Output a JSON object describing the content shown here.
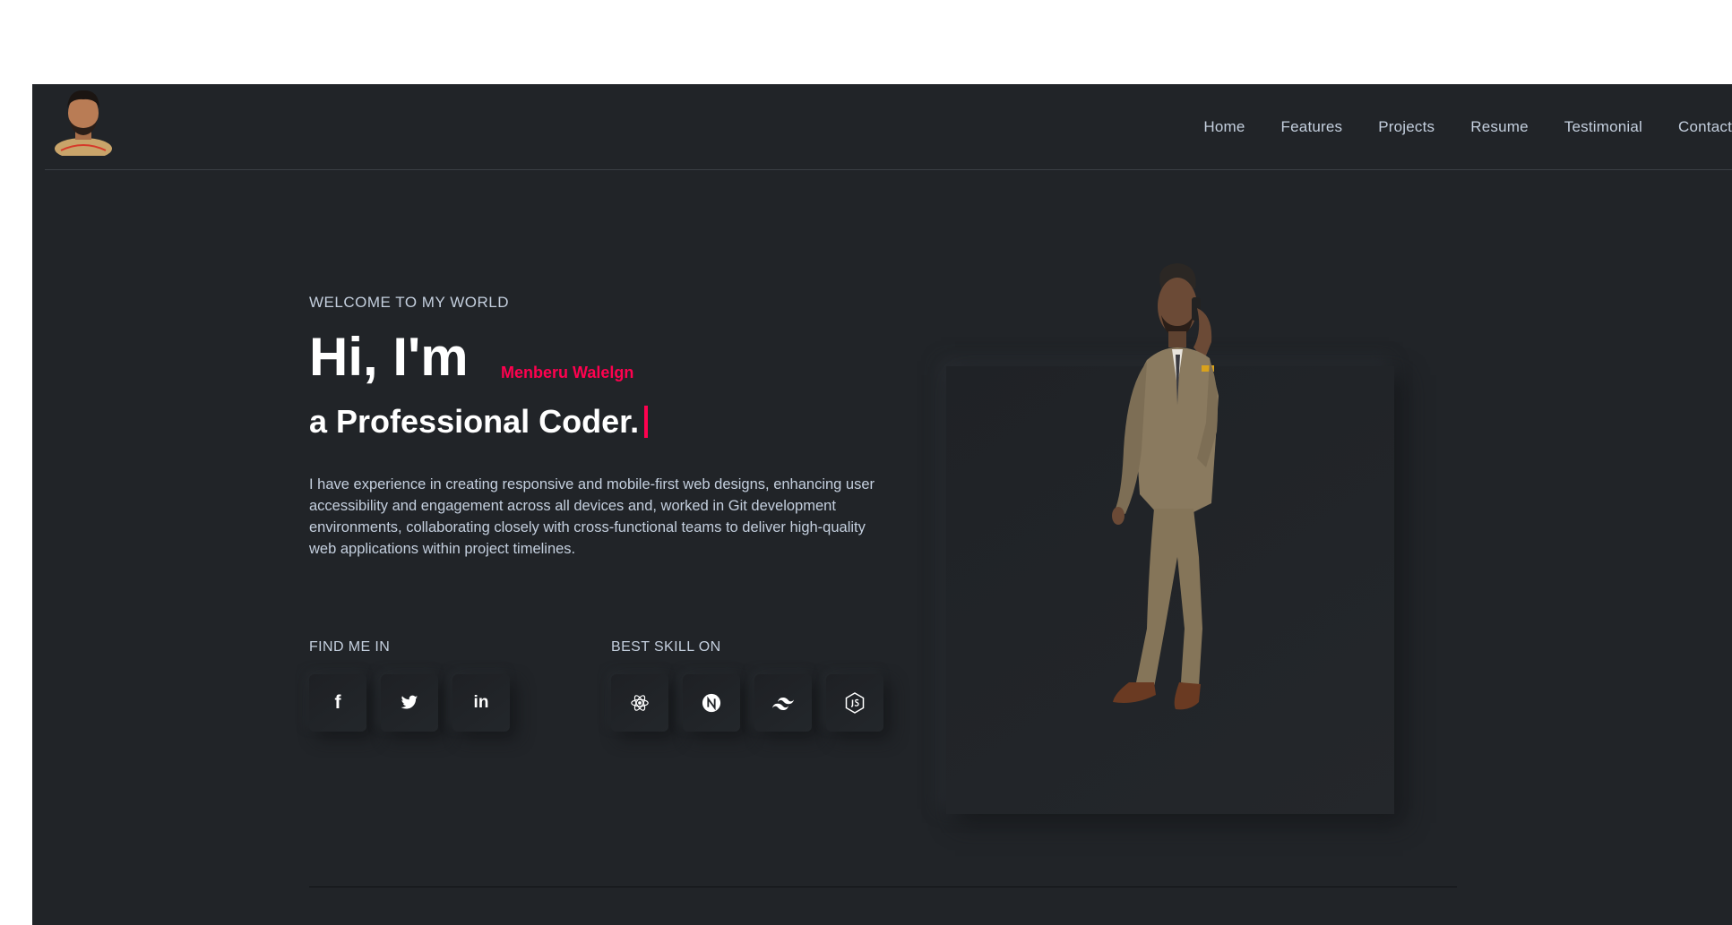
{
  "nav": {
    "items": [
      {
        "label": "Home"
      },
      {
        "label": "Features"
      },
      {
        "label": "Projects"
      },
      {
        "label": "Resume"
      },
      {
        "label": "Testimonial"
      },
      {
        "label": "Contact"
      }
    ]
  },
  "hero": {
    "welcome": "WELCOME TO MY WORLD",
    "greeting": "Hi, I'm",
    "name": "Menberu Walelgn",
    "tagline": "a Professional Coder.",
    "description": "I have experience in creating responsive and mobile-first web designs, enhancing user accessibility and engagement across all devices and, worked in Git development environments, collaborating closely with cross-functional teams to deliver high-quality web applications within project timelines."
  },
  "social": {
    "label": "FIND ME IN",
    "items": [
      {
        "icon": "facebook-icon"
      },
      {
        "icon": "twitter-icon"
      },
      {
        "icon": "linkedin-icon"
      }
    ]
  },
  "skills": {
    "label": "BEST SKILL ON",
    "items": [
      {
        "icon": "react-icon"
      },
      {
        "icon": "nextjs-icon"
      },
      {
        "icon": "tailwind-icon"
      },
      {
        "icon": "nodejs-icon"
      }
    ]
  },
  "colors": {
    "background": "#212428",
    "accent": "#ff014f",
    "text": "#c4cfde"
  }
}
